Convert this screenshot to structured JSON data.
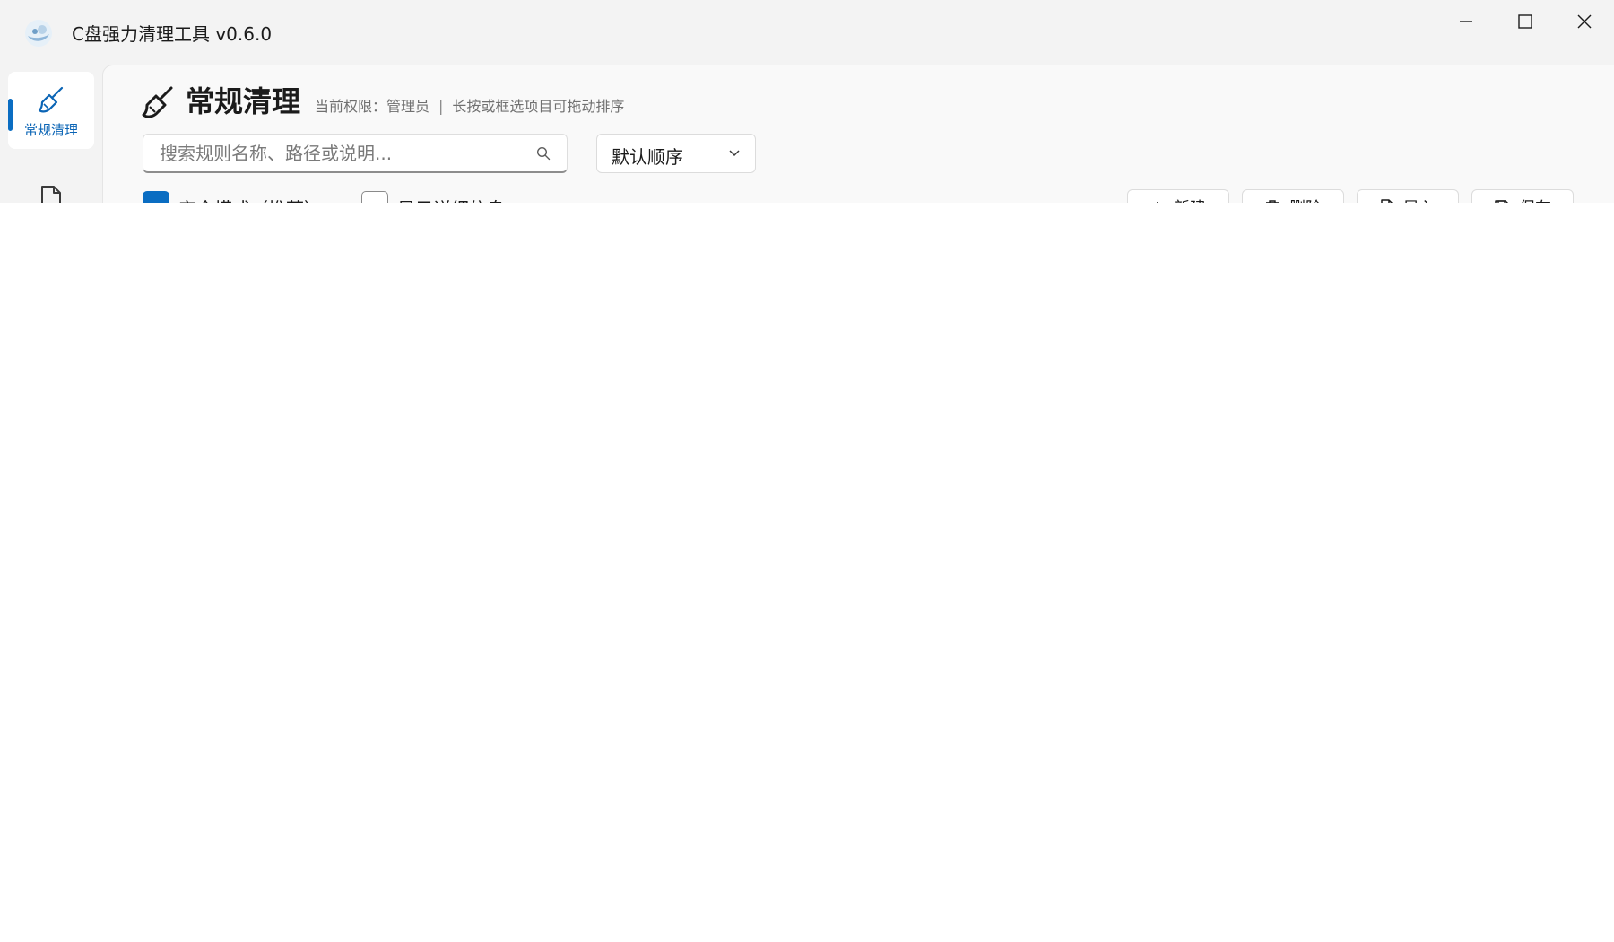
{
  "window": {
    "title": "C盘强力清理工具 v0.6.0",
    "controls": {
      "minimize": "minimize",
      "maximize": "maximize",
      "close": "close"
    }
  },
  "sidebar": {
    "items": [
      {
        "label": "常规清理",
        "icon": "broom-icon",
        "active": true
      },
      {
        "label": "",
        "icon": "document-icon",
        "active": false
      }
    ]
  },
  "header": {
    "title": "常规清理",
    "permission": "当前权限：管理员",
    "hint": "长按或框选项目可拖动排序"
  },
  "search": {
    "placeholder": "搜索规则名称、路径或说明..."
  },
  "sort": {
    "value": "默认顺序"
  },
  "options": {
    "mode_label": "安全模式（推荐）",
    "mode_checked": true,
    "second_label": "显示详细信息",
    "second_checked": false
  },
  "toolbar": {
    "add_label": "新建",
    "delete_label": "删除",
    "import_label": "导入",
    "save_label": "保存"
  },
  "colors": {
    "accent": "#0a6dc2",
    "background": "#f3f3f3",
    "panel": "#f9f9f9"
  }
}
